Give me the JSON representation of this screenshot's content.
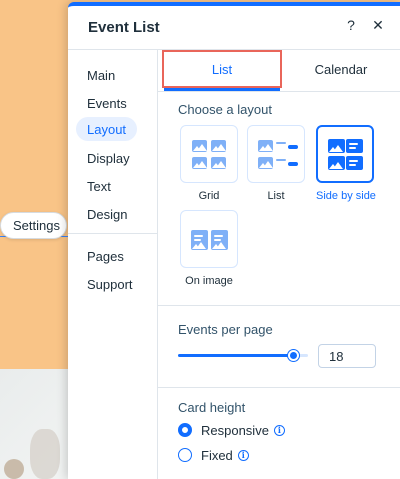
{
  "background": {
    "settings_chip_label": "Settings"
  },
  "panel": {
    "title": "Event List",
    "help_glyph": "?",
    "close_glyph": "✕"
  },
  "sidebar": {
    "items": [
      {
        "label": "Main"
      },
      {
        "label": "Events"
      },
      {
        "label": "Layout"
      },
      {
        "label": "Display"
      },
      {
        "label": "Text"
      },
      {
        "label": "Design"
      },
      {
        "label": "Pages"
      },
      {
        "label": "Support"
      }
    ],
    "active": "Layout"
  },
  "tabs": [
    {
      "label": "List"
    },
    {
      "label": "Calendar"
    }
  ],
  "layout_section": {
    "title": "Choose a layout",
    "options": [
      {
        "label": "Grid",
        "icon": "grid-layout-icon"
      },
      {
        "label": "List",
        "icon": "list-layout-icon"
      },
      {
        "label": "Side by side",
        "icon": "side-by-side-layout-icon"
      },
      {
        "label": "On image",
        "icon": "on-image-layout-icon"
      }
    ],
    "selected": "Side by side"
  },
  "events_per_page": {
    "title": "Events per page",
    "value": "18"
  },
  "card_height": {
    "title": "Card height",
    "options": [
      {
        "label": "Responsive"
      },
      {
        "label": "Fixed"
      }
    ],
    "selected": "Responsive",
    "info_glyph": "i"
  },
  "colors": {
    "accent": "#116dff",
    "accent_light": "#7fb0f7",
    "background_page": "#f9c487",
    "tab_highlight": "#e9655a"
  }
}
